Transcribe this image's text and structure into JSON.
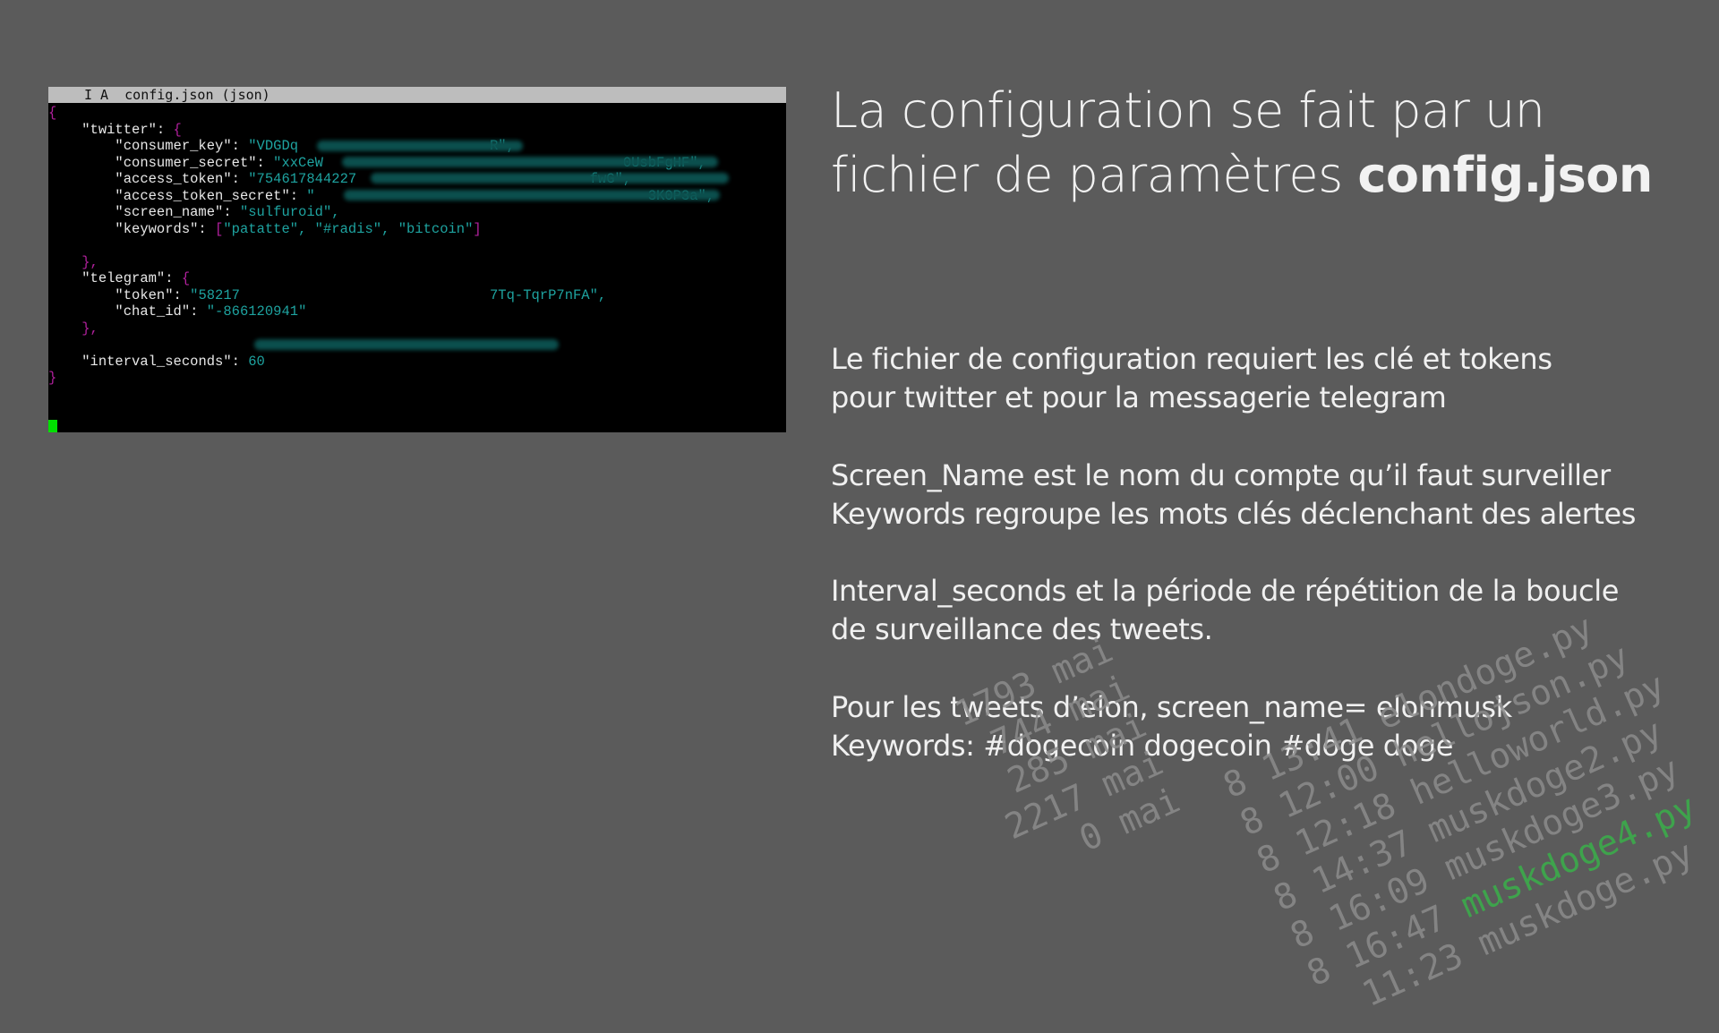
{
  "terminal": {
    "title_bar": "I A  config.json (json)",
    "lines": [
      {
        "k": "",
        "v": "",
        "t": "brace_open"
      },
      {
        "k": "\"twitter\": ",
        "v": "{",
        "t": "obj",
        "indent": 4
      },
      {
        "k": "\"consumer_key\": ",
        "v": "\"VDGDq                       R\",",
        "t": "str",
        "indent": 8
      },
      {
        "k": "\"consumer_secret\": ",
        "v": "\"xxCeW                                    0UsbFgHF\",",
        "t": "str",
        "indent": 8
      },
      {
        "k": "\"access_token\": ",
        "v": "\"754617844227                            fwG\",",
        "t": "str",
        "indent": 8
      },
      {
        "k": "\"access_token_secret\": ",
        "v": "\"                                        3K0P3a\",",
        "t": "str",
        "indent": 8
      },
      {
        "k": "\"screen_name\": ",
        "v": "\"sulfuroid\",",
        "t": "str",
        "indent": 8
      },
      {
        "k": "\"keywords\": ",
        "v": "[\"patatte\", \"#radis\", \"bitcoin\"]",
        "t": "arr",
        "indent": 8
      },
      {
        "k": "",
        "v": "",
        "t": "blank"
      },
      {
        "k": "",
        "v": "},",
        "t": "obj_close",
        "indent": 4
      },
      {
        "k": "\"telegram\": ",
        "v": "{",
        "t": "obj",
        "indent": 4
      },
      {
        "k": "\"token\": ",
        "v": "\"58217                              7Tq-TqrP7nFA\",",
        "t": "str",
        "indent": 8
      },
      {
        "k": "\"chat_id\": ",
        "v": "\"-866120941\"",
        "t": "str",
        "indent": 8
      },
      {
        "k": "",
        "v": "},",
        "t": "obj_close",
        "indent": 4
      },
      {
        "k": "",
        "v": "",
        "t": "blank"
      },
      {
        "k": "\"interval_seconds\": ",
        "v": "60",
        "t": "num",
        "indent": 4
      },
      {
        "k": "",
        "v": "}",
        "t": "brace_close"
      }
    ]
  },
  "slide": {
    "title_line1": "La configuration se fait par un",
    "title_line2_pre": "fichier de paramètres ",
    "title_line2_bold": "config.json",
    "p1_l1": "Le fichier de configuration requiert les clé et tokens",
    "p1_l2": "pour twitter et pour la messagerie telegram",
    "p2_l1": "Screen_Name est le nom du compte qu’il faut surveiller",
    "p2_l2": "Keywords regroupe les mots clés déclenchant des alertes",
    "p3_l1": "Interval_seconds et la période de répétition de la boucle",
    "p3_l2": "de surveillance des tweets.",
    "p4_l1": "Pour les tweets d’elon,  screen_name= elonmusk",
    "p4_l2": "Keywords: #dogecoin dogecoin #doge doge"
  },
  "decoration": {
    "left_col": [
      "1793 mai",
      " 744 mai",
      " 285 mai",
      "2217 mai",
      "   0 mai"
    ],
    "right_col": [
      "8 13:41 elondoge.py",
      "8 12:00 hellojson.py",
      "8 12:18 helloworld.py",
      "8 14:37 muskdoge2.py",
      "8 16:09 muskdoge3.py",
      "8 16:47 muskdoge4.py",
      "  11:23 muskdoge.py"
    ],
    "highlight": "muskdoge4.py",
    "highlight_color": "#3ab04a"
  }
}
